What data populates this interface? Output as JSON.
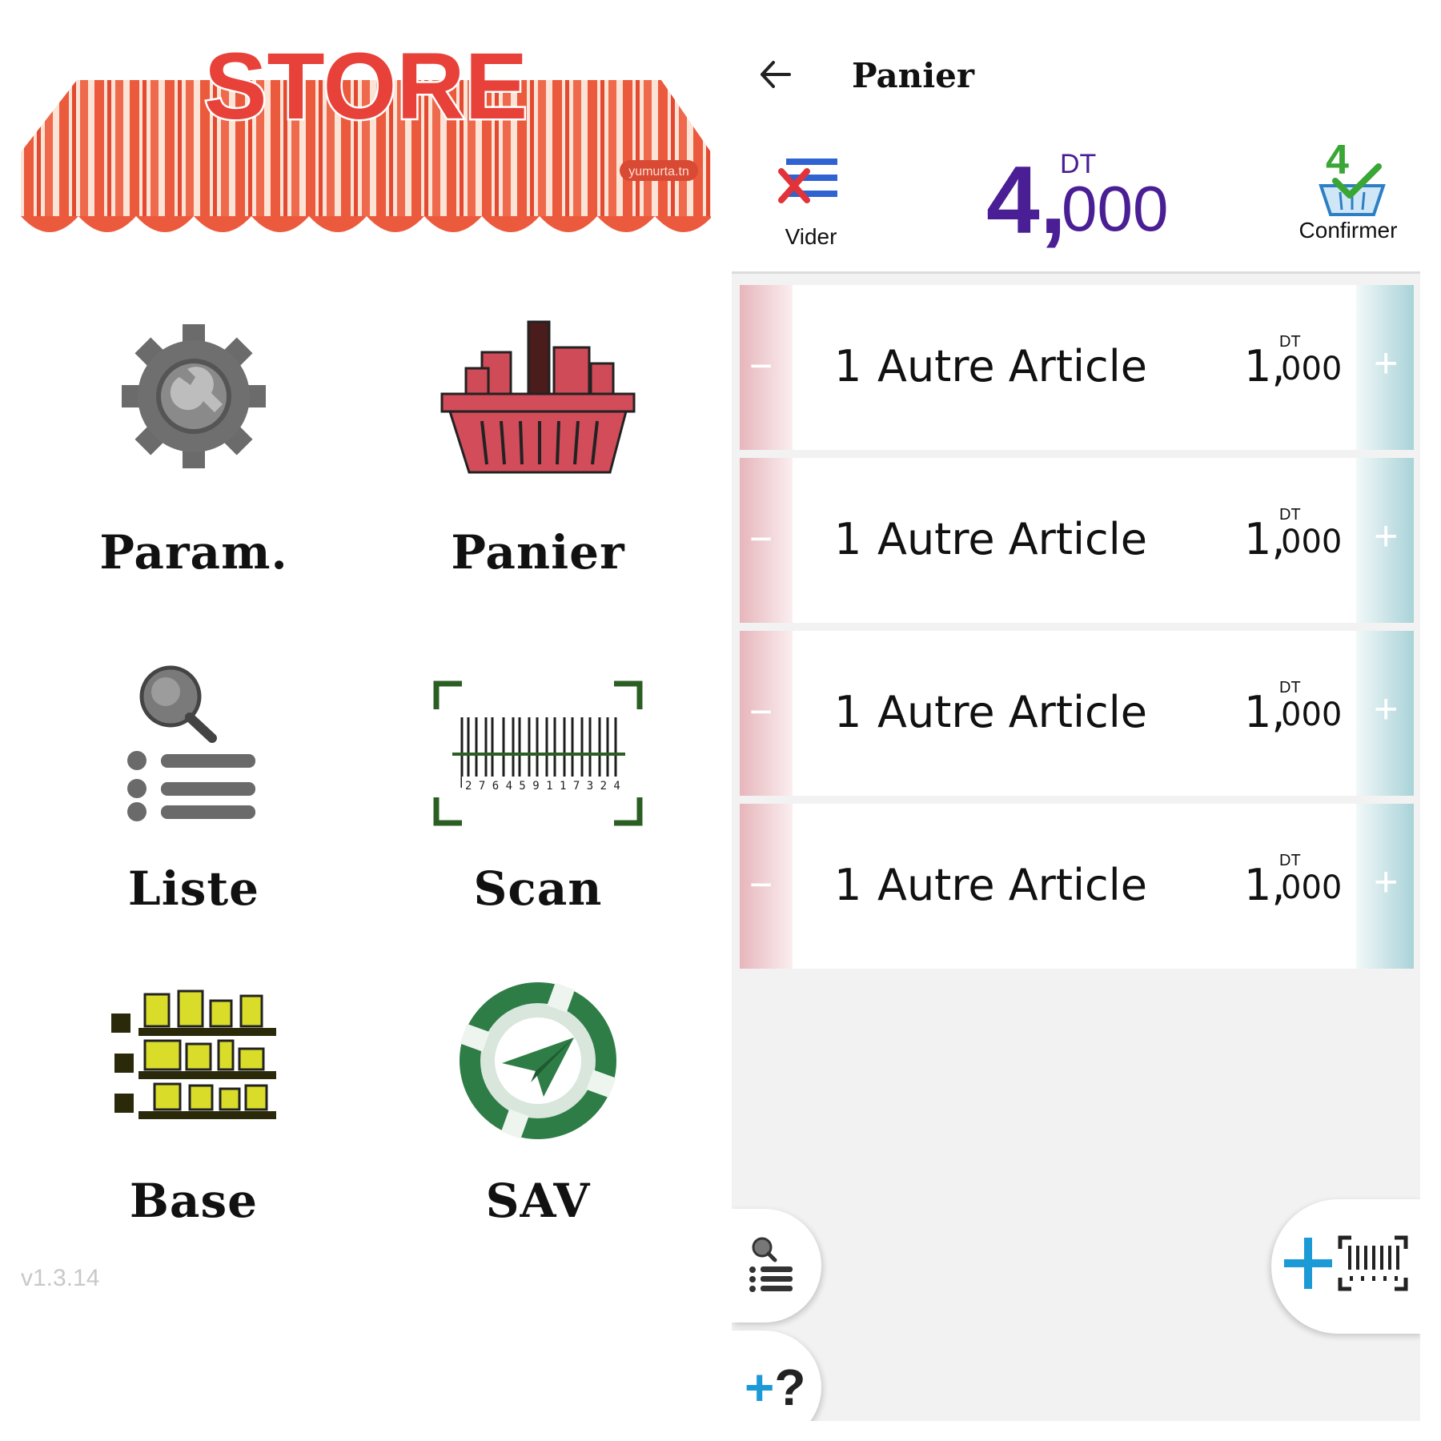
{
  "home": {
    "logo_text": "STORE",
    "logo_watermark": "yumurta.tn",
    "menu": [
      {
        "label": "Param.",
        "icon": "gear-wrench-icon"
      },
      {
        "label": "Panier",
        "icon": "shopping-basket-icon"
      },
      {
        "label": "Liste",
        "icon": "search-list-icon"
      },
      {
        "label": "Scan",
        "icon": "barcode-scan-icon"
      },
      {
        "label": "Base",
        "icon": "shelves-icon"
      },
      {
        "label": "SAV",
        "icon": "paper-plane-support-icon"
      }
    ],
    "version": "v1.3.14"
  },
  "cart": {
    "title": "Panier",
    "back_icon": "arrow-left-icon",
    "clear_label": "Vider",
    "clear_icon": "clear-list-icon",
    "total_int": "4,",
    "total_currency": "DT",
    "total_dec": "000",
    "confirm_count": "4",
    "confirm_label": "Confirmer",
    "confirm_icon": "basket-check-icon",
    "items": [
      {
        "qty": "1",
        "name": "Autre Article",
        "price_int": "1,",
        "currency": "DT",
        "price_dec": "000",
        "minus": "−",
        "plus": "+"
      },
      {
        "qty": "1",
        "name": "Autre Article",
        "price_int": "1,",
        "currency": "DT",
        "price_dec": "000",
        "minus": "−",
        "plus": "+"
      },
      {
        "qty": "1",
        "name": "Autre Article",
        "price_int": "1,",
        "currency": "DT",
        "price_dec": "000",
        "minus": "−",
        "plus": "+"
      },
      {
        "qty": "1",
        "name": "Autre Article",
        "price_int": "1,",
        "currency": "DT",
        "price_dec": "000",
        "minus": "−",
        "plus": "+"
      }
    ],
    "fab_search_icon": "search-list-icon",
    "fab_unknown_plus": "+",
    "fab_unknown_q": "?",
    "fab_scan_icon": "add-barcode-icon"
  },
  "colors": {
    "awning_red": "#ec5a3e",
    "awning_cream": "#fbe3d6",
    "total_purple": "#4a1e94",
    "accent_blue": "#1c9ad6",
    "confirm_green": "#3aa635",
    "minus_strip": "#e6b6bb",
    "plus_strip": "#a9d3d8"
  }
}
